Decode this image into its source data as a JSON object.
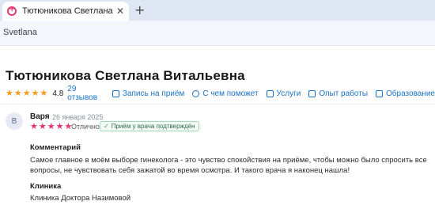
{
  "browser": {
    "tab_title": "Тютюникова Светлана Витальевна",
    "tab_close": "✕",
    "new_tab": "+",
    "url_fragment": "Svetlana"
  },
  "doctor": {
    "name": "Тютюникова Светлана Витальевна",
    "rating_stars": 5,
    "rating_value": "4.8",
    "reviews_link": "29 отзывов",
    "nav": [
      {
        "label": "Запись на приём",
        "icon": "calendar-icon"
      },
      {
        "label": "С чем поможет",
        "icon": "chat-icon"
      },
      {
        "label": "Услуги",
        "icon": "document-icon"
      },
      {
        "label": "Опыт работы",
        "icon": "briefcase-icon"
      },
      {
        "label": "Образование",
        "icon": "graduation-icon"
      }
    ]
  },
  "review": {
    "avatar_letter": "В",
    "author": "Варя",
    "date": "26 января 2025",
    "stars": 5,
    "quality": "Отлично",
    "verified": "Приём у врача подтверждён",
    "comment_heading": "Комментарий",
    "comment": "Самое главное в моём выборе гинеколога - это чувство спокойствия на приёме, чтобы можно было спросить все вопросы, не чувствовать себя зажатой во время осмотра. И такого врача я наконец нашла!",
    "clinic_heading": "Клиника",
    "clinic": "Клиника Доктора Назимовой"
  },
  "colors": {
    "star_rating": "#f49a1c",
    "star_review": "#e8326e",
    "link": "#1a73c8",
    "verified_border": "#9fd9b5"
  }
}
